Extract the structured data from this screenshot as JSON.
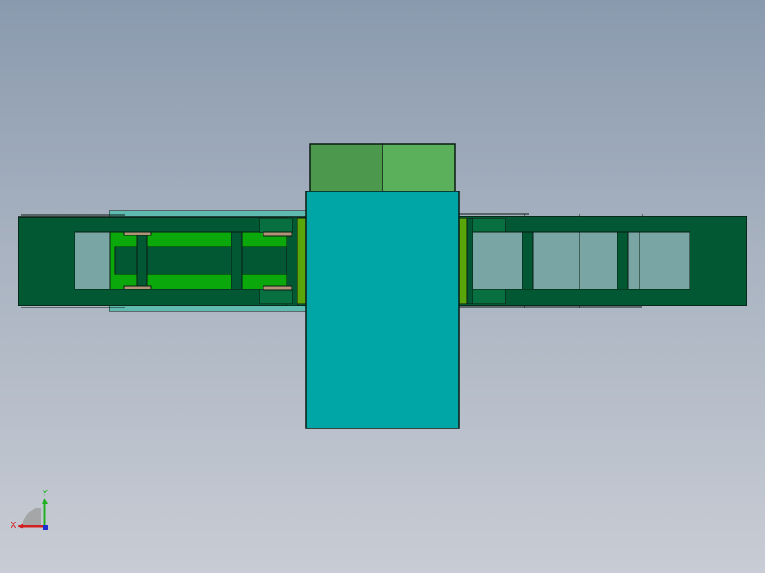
{
  "viewport": {
    "background_top": "#8a9aae",
    "background_bottom": "#c8ccd4"
  },
  "model": {
    "colors": {
      "dark_green": "#025832",
      "bright_green": "#0aa80a",
      "teal": "#00a5a5",
      "glass": "#7aa5a5",
      "top_left": "#4c984c",
      "top_right": "#5bb05b",
      "lime": "#58a60a",
      "tan": "#b09478",
      "light_teal": "#5fbab0",
      "outline": "#0b1a12"
    }
  },
  "triad": {
    "x_label": "X",
    "y_label": "Y",
    "x_color": "#d22020",
    "y_color": "#20b020",
    "z_color": "#2030d0"
  }
}
